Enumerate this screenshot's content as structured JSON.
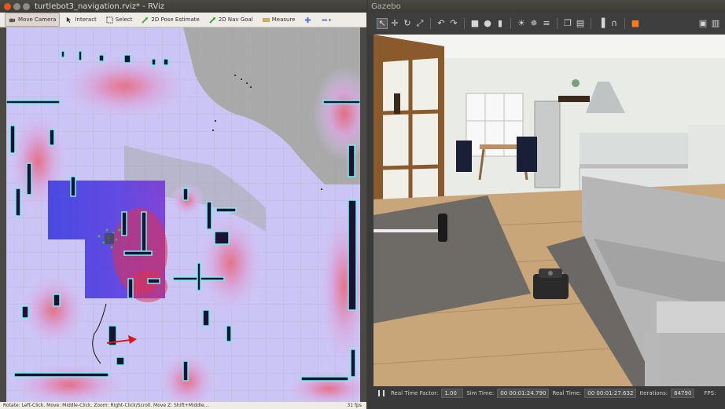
{
  "rviz": {
    "title": "turtlebot3_navigation.rviz* - RViz",
    "tools": [
      {
        "label": "Move Camera",
        "icon": "move-camera-icon"
      },
      {
        "label": "Interact",
        "icon": "interact-icon"
      },
      {
        "label": "Select",
        "icon": "select-icon"
      },
      {
        "label": "2D Pose Estimate",
        "icon": "pose-estimate-icon"
      },
      {
        "label": "2D Nav Goal",
        "icon": "nav-goal-icon"
      },
      {
        "label": "Measure",
        "icon": "measure-icon"
      }
    ],
    "status_text": "Rotate: Left-Click. Move: Middle-Click. Zoom: Right-Click/Scroll. Move Z: Shift+Middle...",
    "fps": "31 fps",
    "colors": {
      "costmap_lavender": "#c8c3f5",
      "costmap_red": "#e8304a",
      "local_blue": "#4a4cf0",
      "wall_dark": "#1c1033",
      "inflation_cyan": "#74f0ee",
      "free_grey": "#a9a9a9"
    }
  },
  "gazebo": {
    "title": "Gazebo",
    "status": {
      "real_time_factor_label": "Real Time Factor:",
      "real_time_factor": "1.00",
      "sim_time_label": "Sim Time:",
      "sim_time": "00 00:01:24.790",
      "real_time_label": "Real Time:",
      "real_time": "00 00:01:27.632",
      "iterations_label": "Iterations:",
      "iterations": "84790",
      "fps_label": "FPS:"
    }
  }
}
